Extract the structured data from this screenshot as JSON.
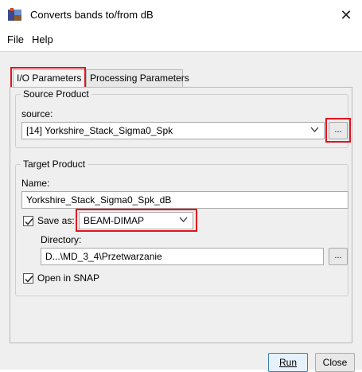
{
  "window": {
    "title": "Converts bands to/from dB",
    "close_glyph": "✕"
  },
  "menu": {
    "items": [
      "File",
      "Help"
    ]
  },
  "tabs": [
    {
      "label": "I/O Parameters",
      "active": true
    },
    {
      "label": "Processing Parameters",
      "active": false
    }
  ],
  "source_product": {
    "legend": "Source Product",
    "label": "source:",
    "value": "[14] Yorkshire_Stack_Sigma0_Spk",
    "browse_label": "..."
  },
  "target_product": {
    "legend": "Target Product",
    "name_label": "Name:",
    "name_value": "Yorkshire_Stack_Sigma0_Spk_dB",
    "save_as": {
      "label": "Save as:",
      "checked": true,
      "format": "BEAM-DIMAP"
    },
    "directory_label": "Directory:",
    "directory_value": "D...\\MD_3_4\\Przetwarzanie",
    "directory_browse_label": "...",
    "open_in_snap": {
      "label": "Open in SNAP",
      "checked": true
    }
  },
  "buttons": {
    "run": "Run",
    "close": "Close"
  },
  "colors": {
    "highlight": "#e3131e",
    "panel_bg": "#efefef",
    "primary_border": "#3c7fb1"
  }
}
